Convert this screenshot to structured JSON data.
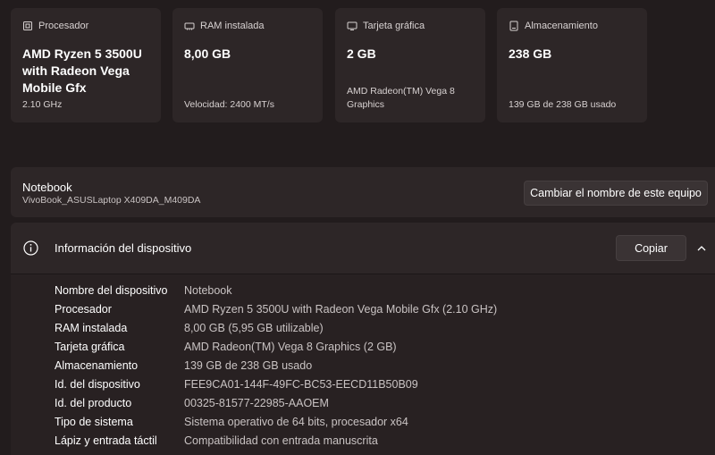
{
  "cards": [
    {
      "header": "Procesador",
      "icon": "processor-icon",
      "value": "AMD Ryzen 5 3500U with Radeon Vega Mobile Gfx",
      "sub": "2.10 GHz"
    },
    {
      "header": "RAM instalada",
      "icon": "ram-icon",
      "value": "8,00 GB",
      "sub": "Velocidad: 2400 MT/s"
    },
    {
      "header": "Tarjeta gráfica",
      "icon": "graphics-card-icon",
      "value": "2 GB",
      "sub": "AMD Radeon(TM) Vega 8 Graphics"
    },
    {
      "header": "Almacenamiento",
      "icon": "storage-icon",
      "value": "238 GB",
      "sub": "139 GB de 238 GB usado"
    }
  ],
  "device": {
    "name": "Notebook",
    "model": "VivoBook_ASUSLaptop X409DA_M409DA",
    "rename_label": "Cambiar el nombre de este equipo"
  },
  "info": {
    "title": "Información del dispositivo",
    "copy_label": "Copiar",
    "rows": [
      {
        "label": "Nombre del dispositivo",
        "value": "Notebook"
      },
      {
        "label": "Procesador",
        "value": "AMD Ryzen 5 3500U with Radeon Vega Mobile Gfx (2.10 GHz)"
      },
      {
        "label": "RAM instalada",
        "value": "8,00 GB (5,95 GB utilizable)"
      },
      {
        "label": "Tarjeta gráfica",
        "value": "AMD Radeon(TM) Vega 8 Graphics (2 GB)"
      },
      {
        "label": "Almacenamiento",
        "value": "139 GB de 238 GB usado"
      },
      {
        "label": "Id. del dispositivo",
        "value": "FEE9CA01-144F-49FC-BC53-EECD11B50B09"
      },
      {
        "label": "Id. del producto",
        "value": "00325-81577-22985-AAOEM"
      },
      {
        "label": "Tipo de sistema",
        "value": "Sistema operativo de 64 bits, procesador x64"
      },
      {
        "label": "Lápiz y entrada táctil",
        "value": "Compatibilidad con entrada manuscrita"
      }
    ]
  }
}
